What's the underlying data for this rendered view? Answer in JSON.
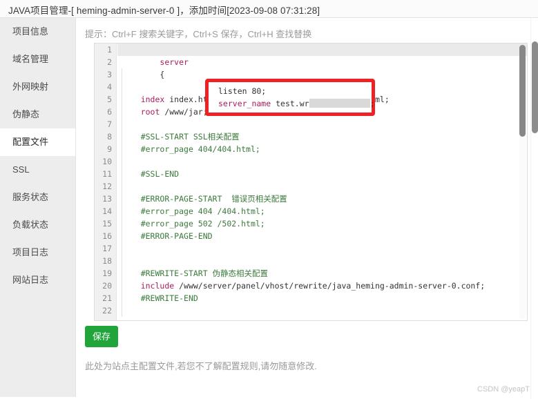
{
  "window": {
    "title": "JAVA项目管理-[ heming-admin-server-0 ]，添加时间[2023-09-08 07:31:28]"
  },
  "sidebar": {
    "items": [
      {
        "label": "项目信息",
        "active": false
      },
      {
        "label": "域名管理",
        "active": false
      },
      {
        "label": "外网映射",
        "active": false
      },
      {
        "label": "伪静态",
        "active": false
      },
      {
        "label": "配置文件",
        "active": true
      },
      {
        "label": "SSL",
        "active": false
      },
      {
        "label": "服务状态",
        "active": false
      },
      {
        "label": "负载状态",
        "active": false
      },
      {
        "label": "项目日志",
        "active": false
      },
      {
        "label": "网站日志",
        "active": false
      }
    ]
  },
  "main": {
    "hint": "提示：Ctrl+F 搜索关键字，Ctrl+S 保存，Ctrl+H 查找替换",
    "save_label": "保存",
    "footer_note": "此处为站点主配置文件,若您不了解配置规则,请勿随意修改.",
    "watermark": "CSDN @yeapT"
  },
  "editor": {
    "line_count": 22,
    "active_line": 1,
    "line_numbers": [
      1,
      2,
      3,
      4,
      5,
      6,
      7,
      8,
      9,
      10,
      11,
      12,
      13,
      14,
      15,
      16,
      17,
      18,
      19,
      20,
      21,
      22
    ],
    "lines": [
      {
        "n": 1,
        "text": "server",
        "type": "keyword"
      },
      {
        "n": 2,
        "text": "{",
        "type": "punct"
      },
      {
        "n": 3,
        "text": "    listen 80;",
        "type": "mixed"
      },
      {
        "n": 4,
        "text": "    server_name test.wr          ;",
        "type": "mixed"
      },
      {
        "n": 5,
        "text": "    index index.html index.htm default.htm default.html;",
        "type": "mixed"
      },
      {
        "n": 6,
        "text": "    root /www/jar;",
        "type": "mixed"
      },
      {
        "n": 7,
        "text": "",
        "type": "blank"
      },
      {
        "n": 8,
        "text": "    #SSL-START SSL相关配置",
        "type": "comment"
      },
      {
        "n": 9,
        "text": "    #error_page 404/404.html;",
        "type": "comment"
      },
      {
        "n": 10,
        "text": "",
        "type": "blank"
      },
      {
        "n": 11,
        "text": "    #SSL-END",
        "type": "comment"
      },
      {
        "n": 12,
        "text": "",
        "type": "blank"
      },
      {
        "n": 13,
        "text": "    #ERROR-PAGE-START  错误页相关配置",
        "type": "comment"
      },
      {
        "n": 14,
        "text": "    #error_page 404 /404.html;",
        "type": "comment"
      },
      {
        "n": 15,
        "text": "    #error_page 502 /502.html;",
        "type": "comment"
      },
      {
        "n": 16,
        "text": "    #ERROR-PAGE-END",
        "type": "comment"
      },
      {
        "n": 17,
        "text": "",
        "type": "blank"
      },
      {
        "n": 18,
        "text": "",
        "type": "blank"
      },
      {
        "n": 19,
        "text": "    #REWRITE-START 伪静态相关配置",
        "type": "comment"
      },
      {
        "n": 20,
        "text": "    include /www/server/panel/vhost/rewrite/java_heming-admin-server-0.conf;",
        "type": "mixed"
      },
      {
        "n": 21,
        "text": "    #REWRITE-END",
        "type": "comment"
      },
      {
        "n": 22,
        "text": "",
        "type": "blank"
      }
    ],
    "tokens": {
      "l1_keyword": "server",
      "l2_brace": "{",
      "l5_keyword": "index",
      "l5_value": " index.html index.htm default.htm default.html;",
      "l6_keyword": "root",
      "l6_value": " /www/jar;",
      "l8": "#SSL-START SSL相关配置",
      "l9": "#error_page 404/404.html;",
      "l11": "#SSL-END",
      "l13": "#ERROR-PAGE-START  错误页相关配置",
      "l14": "#error_page 404 /404.html;",
      "l15": "#error_page 502 /502.html;",
      "l16": "#ERROR-PAGE-END",
      "l19": "#REWRITE-START 伪静态相关配置",
      "l20_keyword": "include",
      "l20_value": " /www/server/panel/vhost/rewrite/java_heming-admin-server-0.conf;",
      "l21": "#REWRITE-END"
    }
  },
  "annotation": {
    "line3_text": "listen 80;",
    "line4_keyword": "server_name",
    "line4_value": " test.wr",
    "line4_suffix": ";",
    "box_color": "#ee2222",
    "redaction_color": "#d9d9d9"
  },
  "colors": {
    "accent_green": "#20a53a",
    "keyword": "#a71d5d",
    "comment": "#3b7a3b",
    "sidebar_bg": "#ededed",
    "gutter_bg": "#f0f0f0"
  }
}
